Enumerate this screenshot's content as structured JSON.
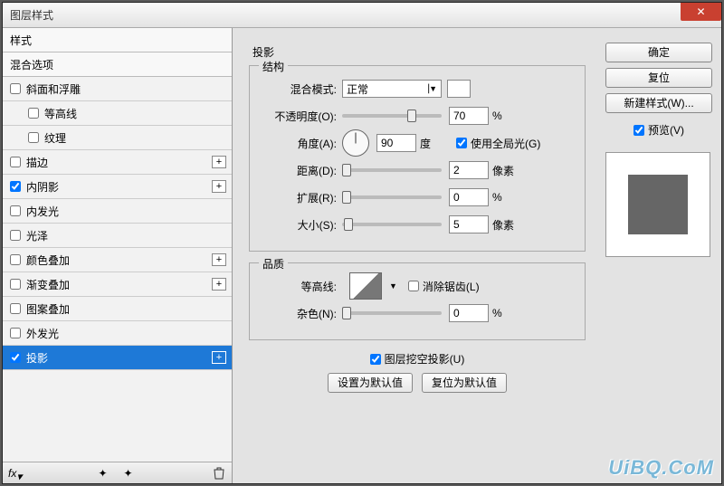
{
  "window": {
    "title": "图层样式"
  },
  "left": {
    "header_styles": "样式",
    "header_blend": "混合选项",
    "items": [
      {
        "label": "斜面和浮雕",
        "checked": false,
        "plus": false,
        "indent": false
      },
      {
        "label": "等高线",
        "checked": false,
        "plus": false,
        "indent": true
      },
      {
        "label": "纹理",
        "checked": false,
        "plus": false,
        "indent": true
      },
      {
        "label": "描边",
        "checked": false,
        "plus": true,
        "indent": false
      },
      {
        "label": "内阴影",
        "checked": true,
        "plus": true,
        "indent": false
      },
      {
        "label": "内发光",
        "checked": false,
        "plus": false,
        "indent": false
      },
      {
        "label": "光泽",
        "checked": false,
        "plus": false,
        "indent": false
      },
      {
        "label": "颜色叠加",
        "checked": false,
        "plus": true,
        "indent": false
      },
      {
        "label": "渐变叠加",
        "checked": false,
        "plus": true,
        "indent": false
      },
      {
        "label": "图案叠加",
        "checked": false,
        "plus": false,
        "indent": false
      },
      {
        "label": "外发光",
        "checked": false,
        "plus": false,
        "indent": false
      },
      {
        "label": "投影",
        "checked": true,
        "plus": true,
        "indent": false,
        "selected": true
      }
    ]
  },
  "center": {
    "title": "投影",
    "structure": {
      "legend": "结构",
      "blend_mode_label": "混合模式:",
      "blend_mode_value": "正常",
      "opacity_label": "不透明度(O):",
      "opacity_value": "70",
      "opacity_unit": "%",
      "angle_label": "角度(A):",
      "angle_value": "90",
      "angle_unit": "度",
      "global_light_label": "使用全局光(G)",
      "global_light_checked": true,
      "distance_label": "距离(D):",
      "distance_value": "2",
      "distance_unit": "像素",
      "spread_label": "扩展(R):",
      "spread_value": "0",
      "spread_unit": "%",
      "size_label": "大小(S):",
      "size_value": "5",
      "size_unit": "像素"
    },
    "quality": {
      "legend": "品质",
      "contour_label": "等高线:",
      "antialias_label": "消除锯齿(L)",
      "antialias_checked": false,
      "noise_label": "杂色(N):",
      "noise_value": "0",
      "noise_unit": "%"
    },
    "knockout_label": "图层挖空投影(U)",
    "knockout_checked": true,
    "btn_default": "设置为默认值",
    "btn_reset": "复位为默认值"
  },
  "right": {
    "ok": "确定",
    "reset": "复位",
    "new_style": "新建样式(W)...",
    "preview_label": "预览(V)",
    "preview_checked": true
  },
  "watermark": "UiBQ.CoM"
}
